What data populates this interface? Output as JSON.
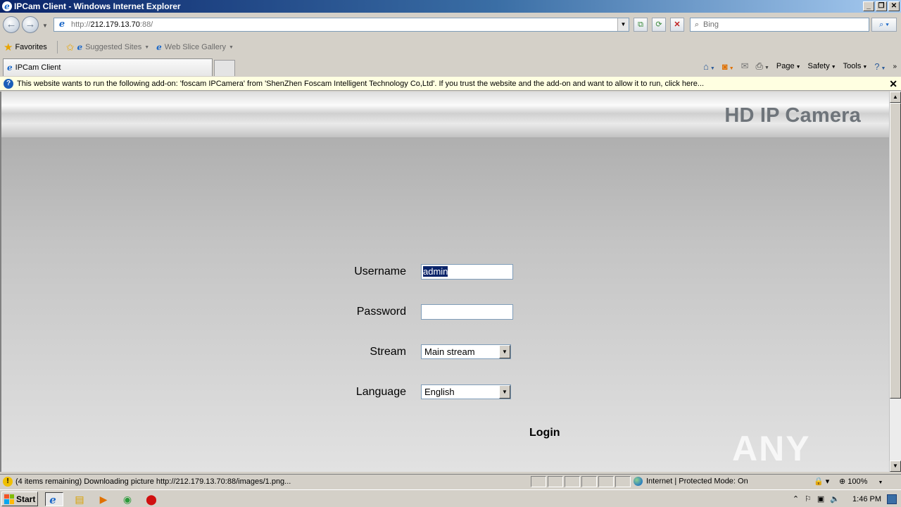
{
  "window": {
    "title": "IPCam Client - Windows Internet Explorer",
    "controls": [
      "_",
      "❐",
      "✕"
    ]
  },
  "address_bar": {
    "url_scheme": "http://",
    "url_host": "212.179.13.70",
    "url_port": ":88/",
    "search_placeholder": "Bing"
  },
  "favorites_bar": {
    "favorites_label": "Favorites",
    "suggested_sites": "Suggested Sites",
    "web_slice_gallery": "Web Slice Gallery"
  },
  "tabs": {
    "active_tab": "IPCam Client"
  },
  "command_bar": {
    "page": "Page",
    "safety": "Safety",
    "tools": "Tools"
  },
  "info_bar": {
    "message": "This website wants to run the following add-on: 'foscam IPCamera' from 'ShenZhen Foscam Intelligent Technology Co,Ltd'. If you trust the website and the add-on and want to allow it to run, click here..."
  },
  "page": {
    "brand": "HD IP Camera",
    "username_label": "Username",
    "username_value": "admin",
    "password_label": "Password",
    "password_value": "",
    "stream_label": "Stream",
    "stream_value": "Main stream",
    "language_label": "Language",
    "language_value": "English",
    "login_label": "Login",
    "watermark": "ANY RUN"
  },
  "status_bar": {
    "message": "(4 items remaining) Downloading picture http://212.179.13.70:88/images/1.png...",
    "zone": "Internet | Protected Mode: On",
    "zoom": "100%"
  },
  "taskbar": {
    "start_label": "Start",
    "clock": "1:46 PM"
  }
}
